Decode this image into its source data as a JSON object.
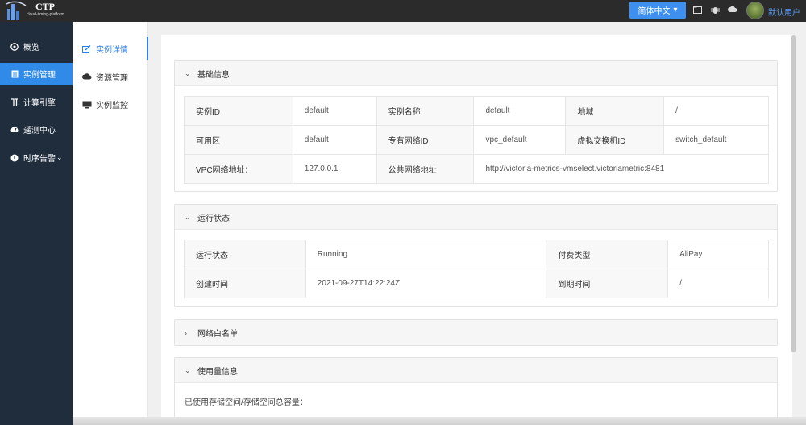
{
  "header": {
    "logo_title": "CTP",
    "logo_subtitle": "cloud-timing-platform",
    "language_button": "简体中文",
    "language_caret": "▾",
    "user_name": "默认用户",
    "icons": [
      "folder-icon",
      "bug-icon",
      "cloud-icon"
    ]
  },
  "sidebar": {
    "items": [
      {
        "label": "概览",
        "icon": "dashboard-icon"
      },
      {
        "label": "实例管理",
        "icon": "document-icon",
        "active": true
      },
      {
        "label": "计算引擎",
        "icon": "engine-icon"
      },
      {
        "label": "遥测中心",
        "icon": "gauge-icon"
      },
      {
        "label": "时序告警",
        "icon": "alert-icon",
        "caret": "⌄"
      }
    ]
  },
  "subnav": {
    "items": [
      {
        "label": "实例详情",
        "icon": "edit-icon",
        "active": true
      },
      {
        "label": "资源管理",
        "icon": "cloud-icon"
      },
      {
        "label": "实例监控",
        "icon": "monitor-icon"
      }
    ]
  },
  "panels": {
    "basic": {
      "title": "基础信息",
      "rows": [
        [
          "实例ID",
          "default",
          "实例名称",
          "default",
          "地域",
          "/"
        ],
        [
          "可用区",
          "default",
          "专有网络ID",
          "vpc_default",
          "虚拟交换机ID",
          "switch_default"
        ],
        [
          "VPC网络地址：",
          "127.0.0.1",
          "公共网络地址",
          "http://victoria-metrics-vmselect.victoriametric:8481"
        ]
      ]
    },
    "status": {
      "title": "运行状态",
      "rows": [
        [
          "运行状态",
          "Running",
          "付费类型",
          "AliPay"
        ],
        [
          "创建时间",
          "2021-09-27T14:22:24Z",
          "到期时间",
          "/"
        ]
      ]
    },
    "whitelist": {
      "title": "网络白名单"
    },
    "usage": {
      "title": "使用量信息",
      "text": "已使用存储空间/存储空间总容量："
    }
  },
  "colors": {
    "topbar": "#2b2b2b",
    "sidebar": "#1f2d3d",
    "accent": "#2f8ae8"
  }
}
